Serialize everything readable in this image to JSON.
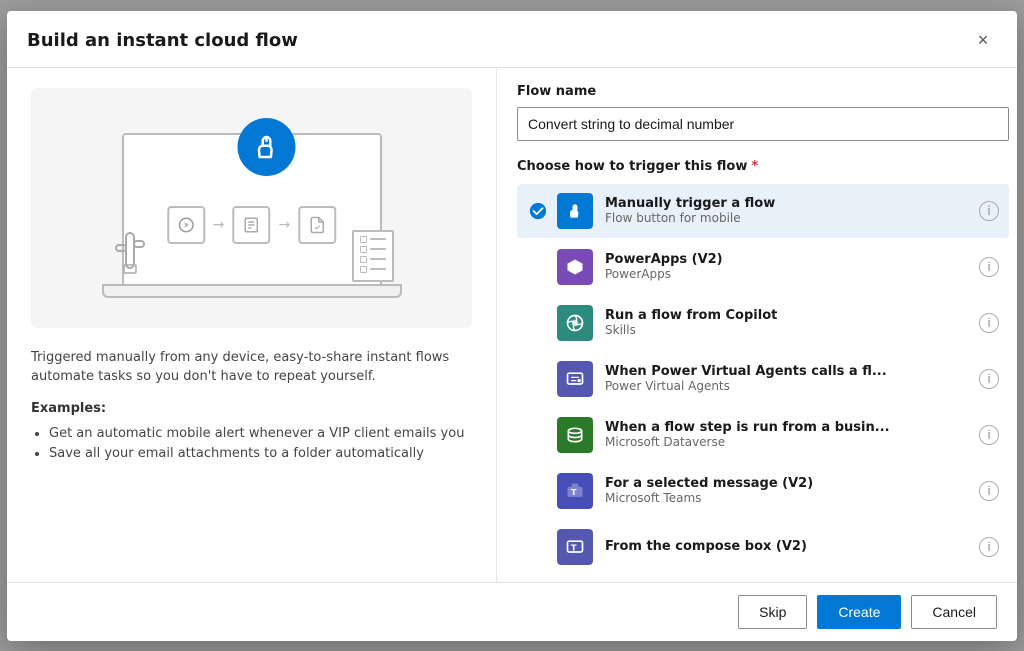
{
  "modal": {
    "title": "Build an instant cloud flow",
    "close_label": "×"
  },
  "left": {
    "description": "Triggered manually from any device, easy-to-share instant flows automate tasks so you don't have to repeat yourself.",
    "examples_label": "Examples:",
    "examples": [
      "Get an automatic mobile alert whenever a VIP client emails you",
      "Save all your email attachments to a folder automatically"
    ]
  },
  "right": {
    "flow_name_label": "Flow name",
    "flow_name_value": "Convert string to decimal number",
    "trigger_label": "Choose how to trigger this flow",
    "triggers": [
      {
        "id": "manually",
        "name": "Manually trigger a flow",
        "sub": "Flow button for mobile",
        "icon_color": "blue",
        "selected": true
      },
      {
        "id": "powerapps",
        "name": "PowerApps (V2)",
        "sub": "PowerApps",
        "icon_color": "purple",
        "selected": false
      },
      {
        "id": "copilot",
        "name": "Run a flow from Copilot",
        "sub": "Skills",
        "icon_color": "teal",
        "selected": false
      },
      {
        "id": "pva",
        "name": "When Power Virtual Agents calls a fl...",
        "sub": "Power Virtual Agents",
        "icon_color": "purple2",
        "selected": false
      },
      {
        "id": "dataverse",
        "name": "When a flow step is run from a busin...",
        "sub": "Microsoft Dataverse",
        "icon_color": "green",
        "selected": false
      },
      {
        "id": "teams",
        "name": "For a selected message (V2)",
        "sub": "Microsoft Teams",
        "icon_color": "teams",
        "selected": false
      },
      {
        "id": "compose",
        "name": "From the compose box (V2)",
        "sub": "",
        "icon_color": "teams2",
        "selected": false
      }
    ]
  },
  "footer": {
    "skip_label": "Skip",
    "create_label": "Create",
    "cancel_label": "Cancel"
  }
}
